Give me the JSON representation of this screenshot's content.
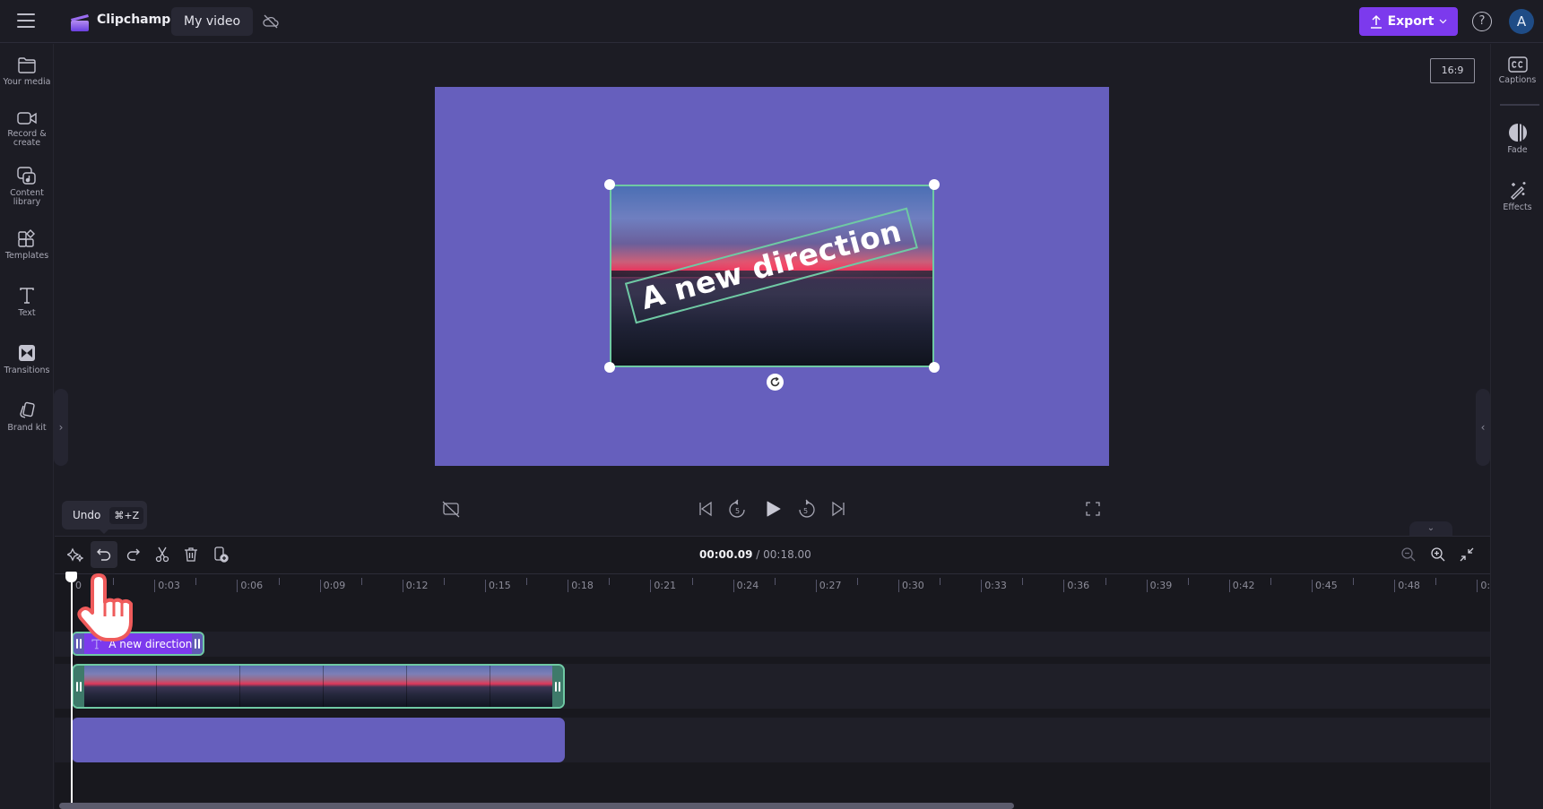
{
  "app": {
    "brand": "Clipchamp",
    "project_name": "My video",
    "export_label": "Export",
    "help_label": "?",
    "avatar_initial": "A",
    "accent_color": "#7c3aed",
    "canvas_color": "#665fbd",
    "selection_color": "#6fc9a4"
  },
  "left_sidebar": {
    "items": [
      {
        "label": "Your media",
        "icon": "folder-icon"
      },
      {
        "label": "Record & create",
        "icon": "video-camera-icon"
      },
      {
        "label": "Content library",
        "icon": "content-library-icon"
      },
      {
        "label": "Templates",
        "icon": "templates-icon"
      },
      {
        "label": "Text",
        "icon": "text-icon"
      },
      {
        "label": "Transitions",
        "icon": "transitions-icon"
      },
      {
        "label": "Brand kit",
        "icon": "brand-kit-icon"
      }
    ]
  },
  "right_sidebar": {
    "items": [
      {
        "label": "Captions",
        "icon": "captions-icon"
      },
      {
        "label": "Fade",
        "icon": "fade-icon"
      },
      {
        "label": "Effects",
        "icon": "magic-wand-icon"
      }
    ]
  },
  "preview": {
    "aspect_ratio": "16:9",
    "overlay_text": "A new direction"
  },
  "timeline": {
    "tooltip": {
      "label": "Undo",
      "shortcut": "⌘+Z"
    },
    "current_time": "00:00.09",
    "total_time": "/ 00:18.00",
    "ruler_labels": [
      "0",
      "0:03",
      "0:06",
      "0:09",
      "0:12",
      "0:15",
      "0:18",
      "0:21",
      "0:24",
      "0:27",
      "0:30",
      "0:33",
      "0:36",
      "0:39",
      "0:42",
      "0:45",
      "0:48",
      "0:"
    ],
    "text_clip_label": "A new direction"
  }
}
